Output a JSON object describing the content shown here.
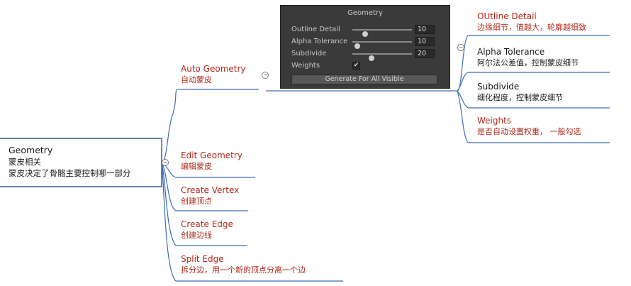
{
  "root": {
    "title": "Geometry",
    "line1": "蒙皮相关",
    "line2": "蒙皮决定了骨骼主要控制哪一部分"
  },
  "branches": {
    "auto_geometry": {
      "title": "Auto Geometry",
      "sub": "自动蒙皮"
    },
    "edit_geometry": {
      "title": "Edit Geometry",
      "sub": "编辑蒙皮"
    },
    "create_vertex": {
      "title": "Create Vertex",
      "sub": "创建顶点"
    },
    "create_edge": {
      "title": "Create Edge",
      "sub": "创建边线"
    },
    "split_edge": {
      "title": "Split Edge",
      "sub": "拆分边，用一个新的顶点分离一个边"
    }
  },
  "auto_children": {
    "outline_detail": {
      "title": "OUtline Detail",
      "sub": "边缘细节，值越大，轮廓越细致"
    },
    "alpha_tolerance": {
      "title": "Alpha Tolerance",
      "sub": "阿尔法公差值，控制蒙皮细节"
    },
    "subdivide": {
      "title": "Subdivide",
      "sub": "细化程度，控制蒙皮细节"
    },
    "weights": {
      "title": "Weights",
      "sub": "是否自动设置权重，    一般勾选"
    }
  },
  "panel": {
    "title": "Geometry",
    "rows": [
      {
        "label": "Outline Detail",
        "value": "10",
        "slider": 0.18
      },
      {
        "label": "Alpha Tolerance",
        "value": "10",
        "slider": 0.04
      },
      {
        "label": "Subdivide",
        "value": "20",
        "slider": 0.3
      },
      {
        "label": "Weights",
        "checked": true
      }
    ],
    "button": "Generate For All Visible"
  },
  "colors": {
    "branch_line": "#3b6cb7",
    "red_text": "#b0281a",
    "dark_text": "#1a1a1a"
  },
  "icons": {
    "collapse": "circle-minus"
  }
}
